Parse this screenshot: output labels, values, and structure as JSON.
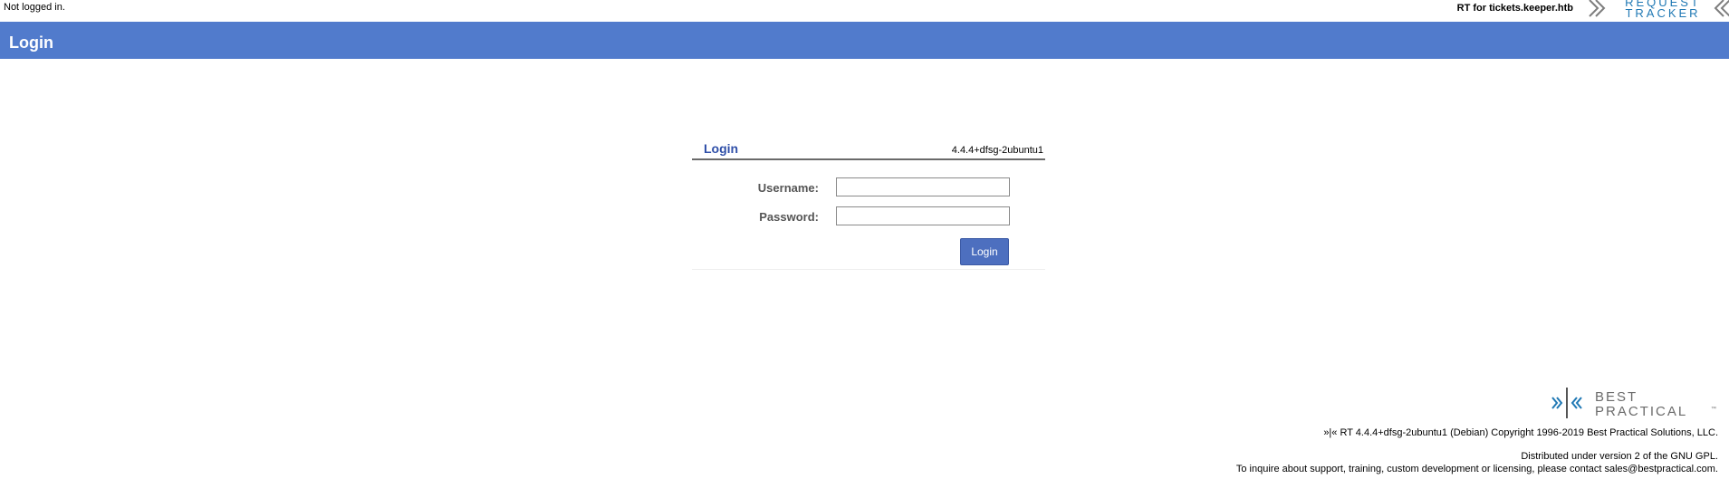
{
  "topbar": {
    "status_text": "Not logged in.",
    "rt_name": "RT for tickets.keeper.htb",
    "logo_line1": "REQUEST",
    "logo_line2": "TRACKER"
  },
  "header": {
    "title": "Login"
  },
  "login_box": {
    "title": "Login",
    "version": "4.4.4+dfsg-2ubuntu1",
    "username_label": "Username:",
    "username_value": "",
    "password_label": "Password:",
    "password_value": "",
    "submit_label": "Login"
  },
  "footer": {
    "logo_line1": "BEST",
    "logo_line2": "PRACTICAL",
    "logo_tm": "™",
    "copyright": "»|« RT 4.4.4+dfsg-2ubuntu1 (Debian) Copyright 1996-2019 Best Practical Solutions, LLC.",
    "license": "Distributed under version 2 of the GNU GPL.",
    "contact": "To inquire about support, training, custom development or licensing, please contact sales@bestpractical.com."
  },
  "colors": {
    "header_bg": "#517bcc",
    "accent": "#4d6fbf",
    "logo_blue": "#1f78b4"
  }
}
